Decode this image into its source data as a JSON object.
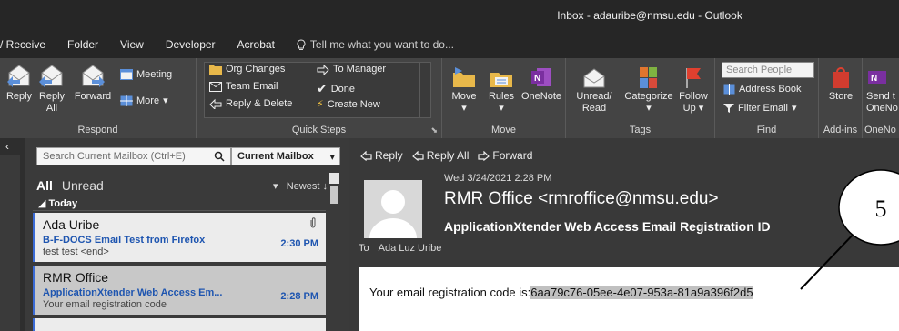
{
  "window": {
    "title": "Inbox - adauribe@nmsu.edu - Outlook"
  },
  "menu": {
    "items": [
      "/ Receive",
      "Folder",
      "View",
      "Developer",
      "Acrobat"
    ],
    "tell_me": "Tell me what you want to do..."
  },
  "ribbon": {
    "respond": {
      "label": "Respond",
      "reply": "Reply",
      "reply_all": "Reply All",
      "forward": "Forward",
      "meeting": "Meeting",
      "more": "More"
    },
    "quick_steps": {
      "label": "Quick Steps",
      "org_changes": "Org Changes",
      "team_email": "Team Email",
      "reply_delete": "Reply & Delete",
      "to_manager": "To Manager",
      "done": "Done",
      "create_new": "Create New"
    },
    "move": {
      "label": "Move",
      "move": "Move",
      "rules": "Rules",
      "onenote": "OneNote"
    },
    "tags": {
      "label": "Tags",
      "unread_read": "Unread/ Read",
      "categorize": "Categorize",
      "follow_up": "Follow Up"
    },
    "find": {
      "label": "Find",
      "search_people": "Search People",
      "address_book": "Address Book",
      "filter_email": "Filter Email"
    },
    "addins": {
      "label": "Add-ins",
      "store": "Store"
    },
    "onenote_grp": {
      "label": "OneNo",
      "send_to": "Send t",
      "onenote": "OneNo"
    }
  },
  "mail_list": {
    "search_placeholder": "Search Current Mailbox (Ctrl+E)",
    "scope": "Current Mailbox",
    "filter_all": "All",
    "filter_unread": "Unread",
    "sort": "Newest",
    "group_today": "Today",
    "items": [
      {
        "from": "Ada Uribe",
        "subject": "B-F-DOCS Email Test from Firefox",
        "preview": "test test <end>",
        "time": "2:30 PM"
      },
      {
        "from": "RMR Office",
        "subject": "ApplicationXtender Web Access Em...",
        "preview": "Your email registration code",
        "time": "2:28 PM"
      }
    ]
  },
  "reading": {
    "actions": {
      "reply": "Reply",
      "reply_all": "Reply All",
      "forward": "Forward"
    },
    "date": "Wed 3/24/2021 2:28 PM",
    "sender": "RMR Office <rmroffice@nmsu.edu>",
    "subject": "ApplicationXtender Web Access Email Registration ID",
    "to_label": "To",
    "to_name": "Ada Luz Uribe",
    "body_text": "Your email registration code is:",
    "code": "6aa79c76-05ee-4e07-953a-81a9a396f2d5"
  },
  "callout": {
    "number": "5"
  }
}
